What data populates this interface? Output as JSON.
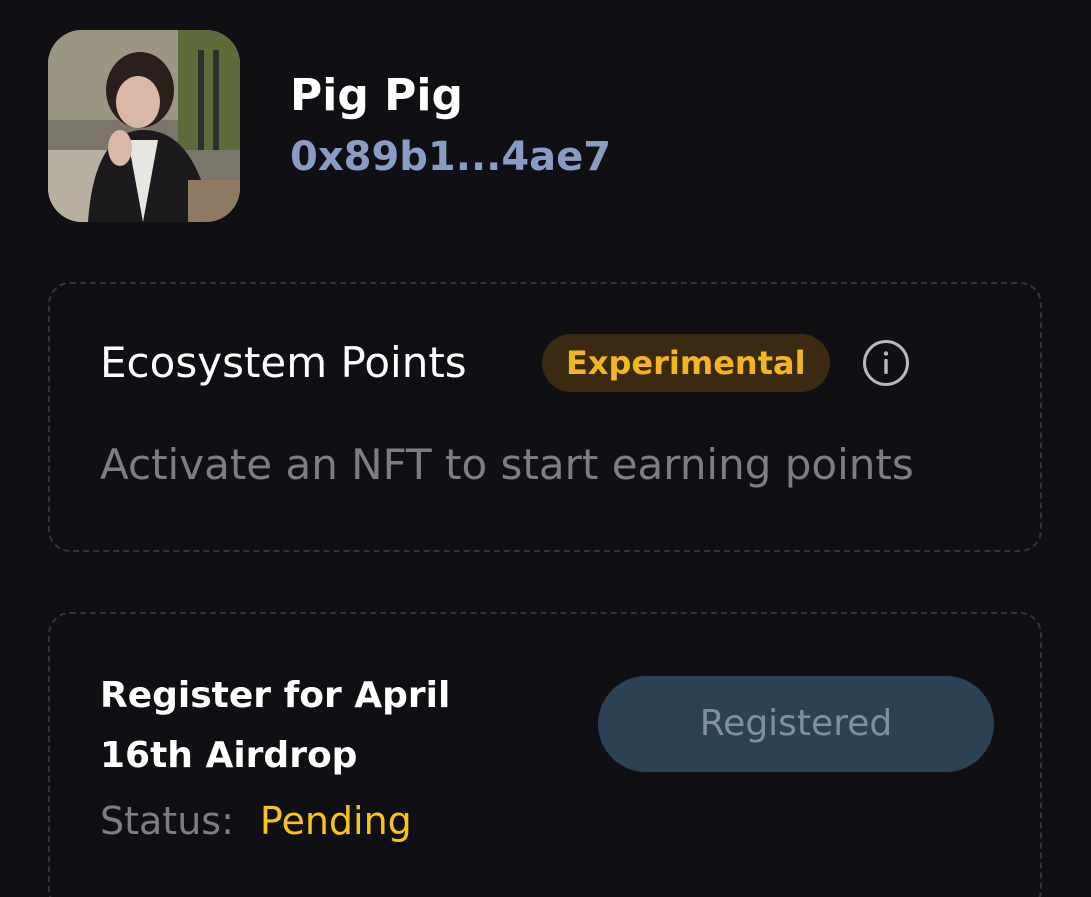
{
  "profile": {
    "name": "Pig Pig",
    "address": "0x89b1...4ae7"
  },
  "points_card": {
    "title": "Ecosystem Points",
    "badge": "Experimental",
    "icon": "info-icon",
    "subtitle": "Activate an NFT to start earning points"
  },
  "airdrop_card": {
    "title": "Register for April 16th Airdrop",
    "status_label": "Status:",
    "status_value": "Pending",
    "button_label": "Registered"
  },
  "colors": {
    "background": "#0f0f14",
    "address": "#8a9cc0",
    "badge_bg": "#3a2a12",
    "badge_text": "#f2b622",
    "status_pending": "#f5c518",
    "button_bg": "#2d4154",
    "button_text": "#7f8f9f",
    "muted_text": "#7d7d86"
  }
}
